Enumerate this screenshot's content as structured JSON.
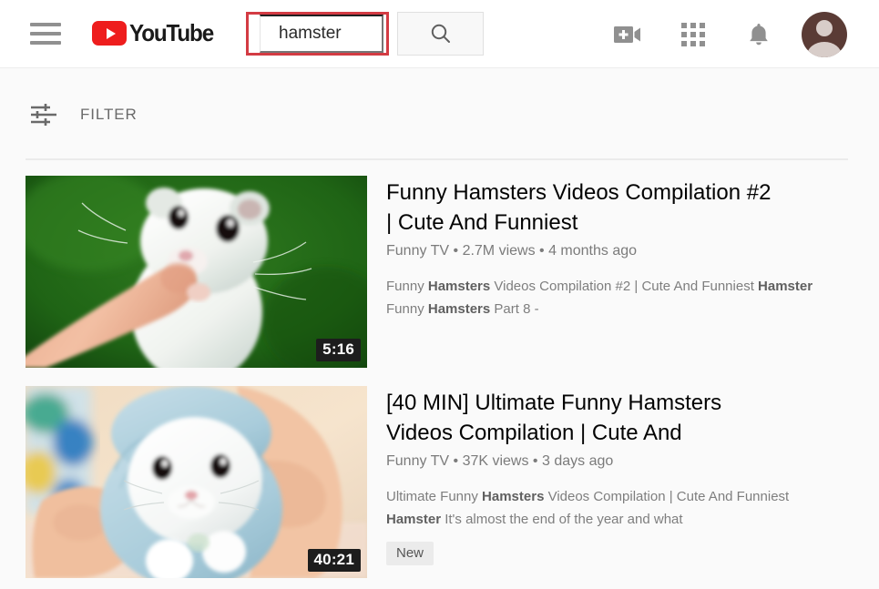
{
  "header": {
    "menu_icon": "hamburger-menu-icon",
    "logo_text": "YouTube",
    "logo_icon": "youtube-play-icon",
    "brand_color": "#ee1d1d",
    "highlight_color": "#d33b43",
    "search": {
      "value": "hamster",
      "placeholder": "Search",
      "button_icon": "search-icon"
    },
    "icons": [
      {
        "name": "create-video-icon",
        "label": "Create"
      },
      {
        "name": "apps-grid-icon",
        "label": "YouTube apps"
      },
      {
        "name": "notifications-bell-icon",
        "label": "Notifications"
      },
      {
        "name": "avatar",
        "label": "Account"
      }
    ]
  },
  "filter_bar": {
    "icon": "tune-filter-icon",
    "label": "FILTER"
  },
  "results": [
    {
      "title": "Funny Hamsters Videos Compilation #2 | Cute And Funniest",
      "channel": "Funny TV",
      "views": "2.7M views",
      "age": "4 months ago",
      "meta": "Funny TV • 2.7M views • 4 months ago",
      "description_html": "Funny <b>Hamsters</b> Videos Compilation #2 | Cute And Funniest <b>Hamster</b> Funny <b>Hamsters</b> Part 8 -",
      "duration": "5:16",
      "badge": null,
      "thumbnail": "white-hamster-eating-from-finger-green-background"
    },
    {
      "title": "[40 MIN] Ultimate Funny Hamsters Videos Compilation | Cute And",
      "channel": "Funny TV",
      "views": "37K views",
      "age": "3 days ago",
      "meta": "Funny TV • 37K views • 3 days ago",
      "description_html": "Ultimate Funny <b>Hamsters</b> Videos Compilation | Cute And Funniest <b>Hamster</b> It's almost the end of the year and what",
      "duration": "40:21",
      "badge": "New",
      "thumbnail": "hamster-in-blue-hoodie-held-by-hands"
    }
  ]
}
